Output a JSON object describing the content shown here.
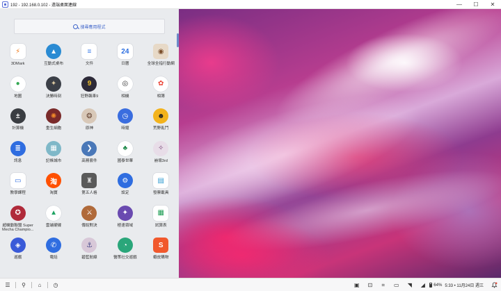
{
  "window": {
    "title": "192 - 192.168.0.102 - 遠端桌面連線",
    "minimize": "—",
    "maximize": "☐",
    "close": "✕"
  },
  "drawer": {
    "search_placeholder": "搜尋應用程式",
    "apps": [
      {
        "label": "3DMark",
        "icon": "3dmark-icon",
        "glyph": "⚡",
        "color": "#ffffff",
        "fg": "#f07c1e",
        "shape": "sq"
      },
      {
        "label": "互動式桌布",
        "icon": "mountain-icon",
        "glyph": "▲",
        "color": "#2a8bd3",
        "fg": "#ffffff",
        "shape": "round"
      },
      {
        "label": "文件",
        "icon": "docs-icon",
        "glyph": "≡",
        "color": "#ffffff",
        "fg": "#3b7be8",
        "shape": "sq"
      },
      {
        "label": "日曆",
        "icon": "calendar-icon",
        "glyph": "24",
        "color": "#ffffff",
        "fg": "#2b6de0",
        "shape": "sq"
      },
      {
        "label": "全球全指行動網",
        "icon": "globe-app-icon",
        "glyph": "◉",
        "color": "#e7d9c7",
        "fg": "#7a4d2a",
        "shape": "sq"
      },
      {
        "label": "地圖",
        "icon": "maps-icon",
        "glyph": "●",
        "color": "#ffffff",
        "fg": "#34a853",
        "shape": "round"
      },
      {
        "label": "決勝時刻",
        "icon": "call-of-duty-icon",
        "glyph": "✦",
        "color": "#3b3f47",
        "fg": "#d9c7a0",
        "shape": "round"
      },
      {
        "label": "狂野飆車9",
        "icon": "asphalt-icon",
        "glyph": "9",
        "color": "#2d2a38",
        "fg": "#f0c02a",
        "shape": "round"
      },
      {
        "label": "相機",
        "icon": "camera-icon",
        "glyph": "◎",
        "color": "#ffffff",
        "fg": "#333333",
        "shape": "round"
      },
      {
        "label": "相簿",
        "icon": "photos-icon",
        "glyph": "✿",
        "color": "#ffffff",
        "fg": "#ea4335",
        "shape": "round"
      },
      {
        "label": "計算機",
        "icon": "calculator-icon",
        "glyph": "±",
        "color": "#3a3d42",
        "fg": "#ffffff",
        "shape": "round"
      },
      {
        "label": "重生細胞",
        "icon": "dead-cells-icon",
        "glyph": "✺",
        "color": "#7a2a2a",
        "fg": "#f08a2a",
        "shape": "round"
      },
      {
        "label": "原神",
        "icon": "genshin-icon",
        "glyph": "❂",
        "color": "#d8c8b8",
        "fg": "#6a4a3a",
        "shape": "round"
      },
      {
        "label": "時鐘",
        "icon": "clock-icon",
        "glyph": "◷",
        "color": "#3a6ddf",
        "fg": "#ffffff",
        "shape": "round"
      },
      {
        "label": "荒野亂鬥",
        "icon": "brawl-stars-icon",
        "glyph": "☻",
        "color": "#f3b31c",
        "fg": "#222222",
        "shape": "round"
      },
      {
        "label": "訊息",
        "icon": "messages-icon",
        "glyph": "≣",
        "color": "#2f6de0",
        "fg": "#ffffff",
        "shape": "round"
      },
      {
        "label": "記帳城市",
        "icon": "city-icon",
        "glyph": "▦",
        "color": "#7fb8c8",
        "fg": "#ffffff",
        "shape": "round"
      },
      {
        "label": "高務套件",
        "icon": "connect-icon",
        "glyph": "❯",
        "color": "#4a78b8",
        "fg": "#ffffff",
        "shape": "round"
      },
      {
        "label": "國泰世華",
        "icon": "cathay-icon",
        "glyph": "♣",
        "color": "#ffffff",
        "fg": "#1f8a4a",
        "shape": "round"
      },
      {
        "label": "崩壞3rd",
        "icon": "honkai-icon",
        "glyph": "✧",
        "color": "#e8dde8",
        "fg": "#7a4a7a",
        "shape": "round"
      },
      {
        "label": "教學課程",
        "icon": "tutorial-icon",
        "glyph": "▭",
        "color": "#ffffff",
        "fg": "#2f6de0",
        "shape": "sq"
      },
      {
        "label": "淘寶",
        "icon": "taobao-icon",
        "glyph": "淘",
        "color": "#ff5000",
        "fg": "#ffffff",
        "shape": "round"
      },
      {
        "label": "第五人格",
        "icon": "identity-v-icon",
        "glyph": "♜",
        "color": "#5a5a5a",
        "fg": "#e0e0e0",
        "shape": "sq"
      },
      {
        "label": "設定",
        "icon": "settings-icon",
        "glyph": "⚙",
        "color": "#2f6de0",
        "fg": "#ffffff",
        "shape": "round"
      },
      {
        "label": "發票載具",
        "icon": "invoice-icon",
        "glyph": "▤",
        "color": "#ffffff",
        "fg": "#2f9ad0",
        "shape": "sq"
      },
      {
        "label": "超機動聯盟 Super Mecha Champio...",
        "icon": "mecha-icon",
        "glyph": "✪",
        "color": "#b02a3a",
        "fg": "#ffffff",
        "shape": "round"
      },
      {
        "label": "雲端硬碟",
        "icon": "drive-icon",
        "glyph": "▲",
        "color": "#ffffff",
        "fg": "#1fa463",
        "shape": "round"
      },
      {
        "label": "傳說對決",
        "icon": "aov-icon",
        "glyph": "⚔",
        "color": "#b06a3a",
        "fg": "#ffffff",
        "shape": "round"
      },
      {
        "label": "極速領域",
        "icon": "qq-speed-icon",
        "glyph": "✦",
        "color": "#6a4ab0",
        "fg": "#ffffff",
        "shape": "round"
      },
      {
        "label": "試算表",
        "icon": "sheets-icon",
        "glyph": "▦",
        "color": "#ffffff",
        "fg": "#1f9d55",
        "shape": "sq"
      },
      {
        "label": "遊戲",
        "icon": "game-controller-icon",
        "glyph": "◈",
        "color": "#3a5ad8",
        "fg": "#ffffff",
        "shape": "round"
      },
      {
        "label": "電話",
        "icon": "phone-icon",
        "glyph": "✆",
        "color": "#2f6de0",
        "fg": "#ffffff",
        "shape": "round"
      },
      {
        "label": "碧藍航線",
        "icon": "azur-lane-icon",
        "glyph": "⚓",
        "color": "#d8c8d8",
        "fg": "#4a4a8a",
        "shape": "round"
      },
      {
        "label": "醫策社交遊戲",
        "icon": "time-icon",
        "glyph": "◔",
        "color": "#2aa67a",
        "fg": "#ffffff",
        "shape": "round"
      },
      {
        "label": "蝦皮購物",
        "icon": "shopee-icon",
        "glyph": "S",
        "color": "#f1582c",
        "fg": "#ffffff",
        "shape": "sq"
      }
    ]
  },
  "taskbar": {
    "left": [
      {
        "icon": "menu-icon",
        "glyph": "☰"
      },
      {
        "icon": "search-icon",
        "glyph": "⚲"
      },
      {
        "icon": "home-icon",
        "glyph": "⌂"
      },
      {
        "icon": "history-icon",
        "glyph": "◷"
      }
    ],
    "right": [
      {
        "icon": "screenshot-icon",
        "glyph": "▣"
      },
      {
        "icon": "lock-icon",
        "glyph": "⊡"
      },
      {
        "icon": "crop-icon",
        "glyph": "⌗"
      },
      {
        "icon": "cast-icon",
        "glyph": "▭"
      },
      {
        "icon": "wifi-icon",
        "glyph": "◥"
      },
      {
        "icon": "signal-icon",
        "glyph": "◢"
      }
    ],
    "battery": "64%",
    "clock": "5:33 • 11月24日 週三",
    "notification_icon": "bell-icon"
  }
}
